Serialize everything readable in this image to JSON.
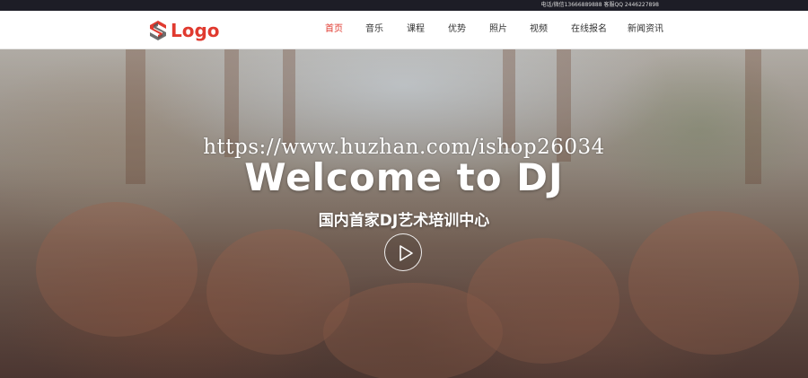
{
  "topbar": {
    "contact_text": "电话/微信13666889888 客服QQ 2446227898"
  },
  "header": {
    "logo_text": "Logo",
    "brand_color": "#e03a2f",
    "nav": [
      {
        "label": "首页",
        "active": true
      },
      {
        "label": "音乐",
        "active": false
      },
      {
        "label": "课程",
        "active": false
      },
      {
        "label": "优势",
        "active": false
      },
      {
        "label": "照片",
        "active": false
      },
      {
        "label": "视频",
        "active": false
      },
      {
        "label": "在线报名",
        "active": false
      },
      {
        "label": "新闻资讯",
        "active": false
      }
    ]
  },
  "hero": {
    "watermark": "https://www.huzhan.com/ishop26034",
    "title": "Welcome to DJ",
    "subtitle": "国内首家DJ艺术培训中心",
    "play_icon": "play-icon"
  }
}
